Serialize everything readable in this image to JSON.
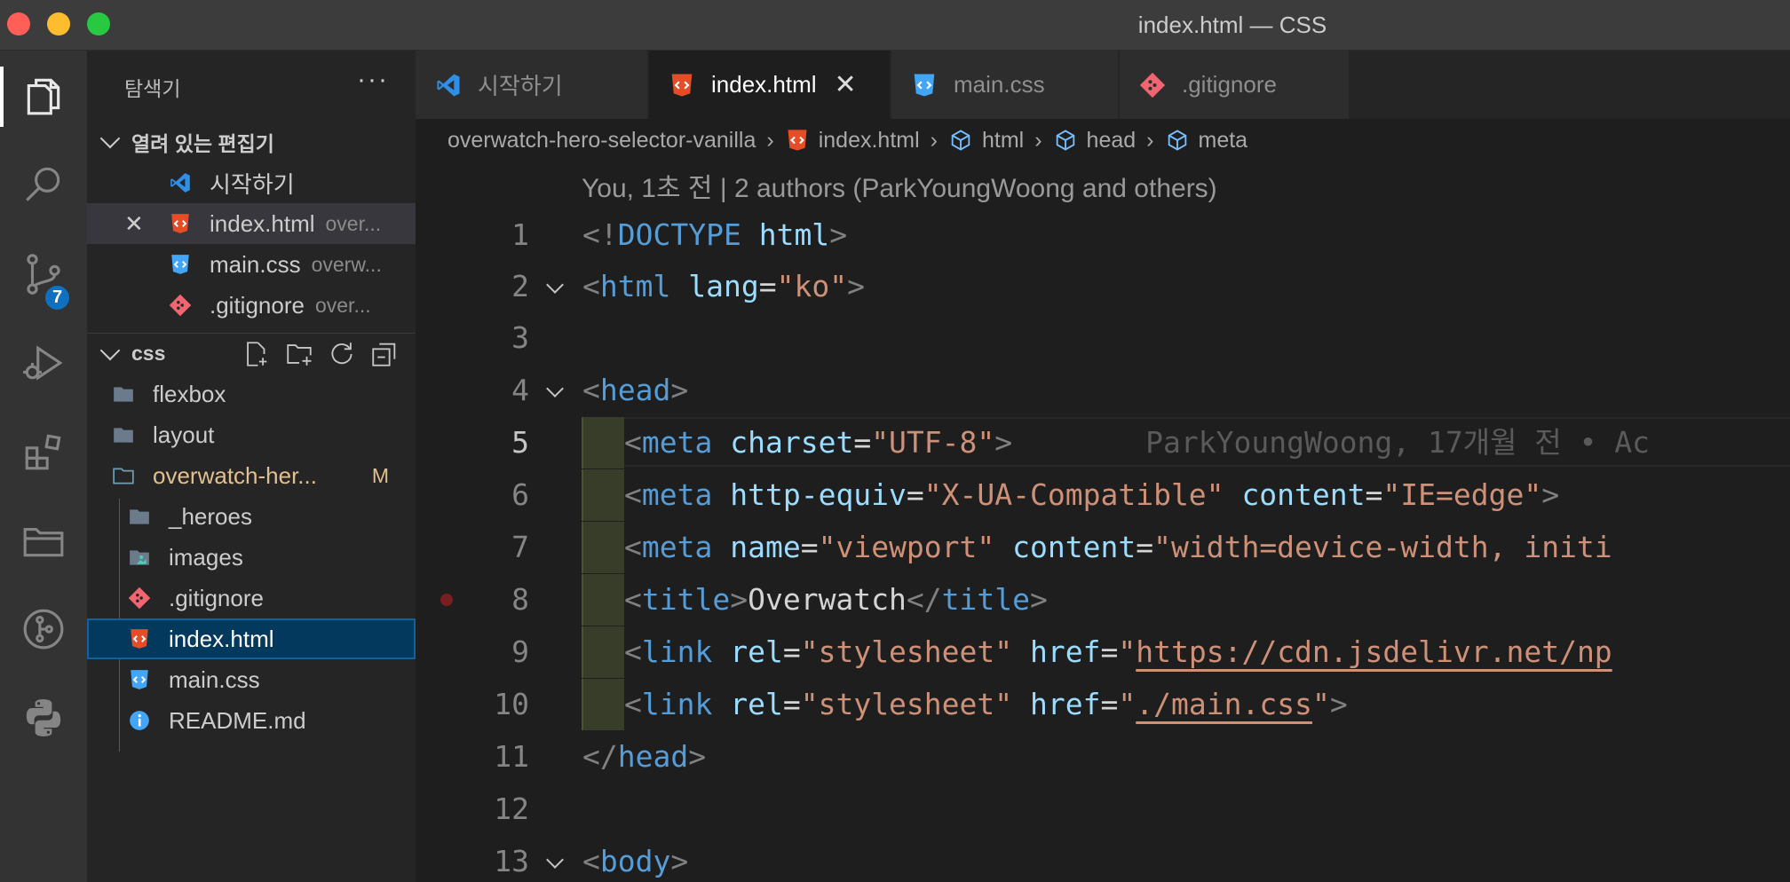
{
  "window": {
    "title": "index.html — CSS"
  },
  "activity": {
    "scm_badge": "7"
  },
  "sidebar": {
    "title": "탐색기",
    "more": "···",
    "open_editors": {
      "title": "열려 있는 편집기",
      "items": [
        {
          "name": "시작하기",
          "desc": ""
        },
        {
          "name": "index.html",
          "desc": "over..."
        },
        {
          "name": "main.css",
          "desc": "overw..."
        },
        {
          "name": ".gitignore",
          "desc": "over..."
        }
      ]
    },
    "workspace": {
      "title": "css",
      "items": [
        {
          "name": "flexbox"
        },
        {
          "name": "layout"
        },
        {
          "name": "overwatch-her...",
          "status": "M"
        },
        {
          "name": "_heroes"
        },
        {
          "name": "images"
        },
        {
          "name": ".gitignore"
        },
        {
          "name": "index.html"
        },
        {
          "name": "main.css"
        },
        {
          "name": "README.md"
        }
      ]
    }
  },
  "tabs": [
    {
      "label": "시작하기"
    },
    {
      "label": "index.html",
      "close": "✕"
    },
    {
      "label": "main.css"
    },
    {
      "label": ".gitignore"
    }
  ],
  "breadcrumbs": [
    "overwatch-hero-selector-vanilla",
    "index.html",
    "html",
    "head",
    "meta"
  ],
  "codelens": "You, 1초 전 | 2 authors (ParkYoungWoong and others)",
  "code": {
    "line_numbers": [
      "1",
      "2",
      "3",
      "4",
      "5",
      "6",
      "7",
      "8",
      "9",
      "10",
      "11",
      "12",
      "13"
    ],
    "l1": {
      "p1": "<!",
      "tag": "DOCTYPE",
      "attr": "html",
      "p2": ">"
    },
    "l2": {
      "p1": "<",
      "tag": "html",
      "attr": "lang",
      "eq": "=",
      "val": "\"ko\"",
      "p2": ">"
    },
    "l4": {
      "p1": "<",
      "tag": "head",
      "p2": ">"
    },
    "l5": {
      "p1": "<",
      "tag": "meta",
      "attr": "charset",
      "eq": "=",
      "val": "\"UTF-8\"",
      "p2": ">",
      "blame": "ParkYoungWoong, 17개월 전 • Ac"
    },
    "l6": {
      "p1": "<",
      "tag": "meta",
      "a1": "http-equiv",
      "eq1": "=",
      "v1": "\"X-UA-Compatible\"",
      "a2": "content",
      "eq2": "=",
      "v2": "\"IE=edge\"",
      "p2": ">"
    },
    "l7": {
      "p1": "<",
      "tag": "meta",
      "a1": "name",
      "eq1": "=",
      "v1": "\"viewport\"",
      "a2": "content",
      "eq2": "=",
      "v2": "\"width=device-width, initi"
    },
    "l8": {
      "p1": "<",
      "tag": "title",
      "p2": ">",
      "text": "Overwatch",
      "p3": "</",
      "tag2": "title",
      "p4": ">"
    },
    "l9": {
      "p1": "<",
      "tag": "link",
      "a1": "rel",
      "eq1": "=",
      "v1": "\"stylesheet\"",
      "a2": "href",
      "eq2": "=",
      "q": "\"",
      "url": "https://cdn.jsdelivr.net/np"
    },
    "l10": {
      "p1": "<",
      "tag": "link",
      "a1": "rel",
      "eq1": "=",
      "v1": "\"stylesheet\"",
      "a2": "href",
      "eq2": "=",
      "q": "\"",
      "url": "./main.css",
      "q2": "\"",
      "p2": ">"
    },
    "l11": {
      "p1": "</",
      "tag": "head",
      "p2": ">"
    },
    "l13": {
      "p1": "<",
      "tag": "body",
      "p2": ">"
    }
  },
  "colors": {
    "accent": "#0e70c0",
    "selection": "#04395e",
    "modified": "#e2c08d"
  }
}
